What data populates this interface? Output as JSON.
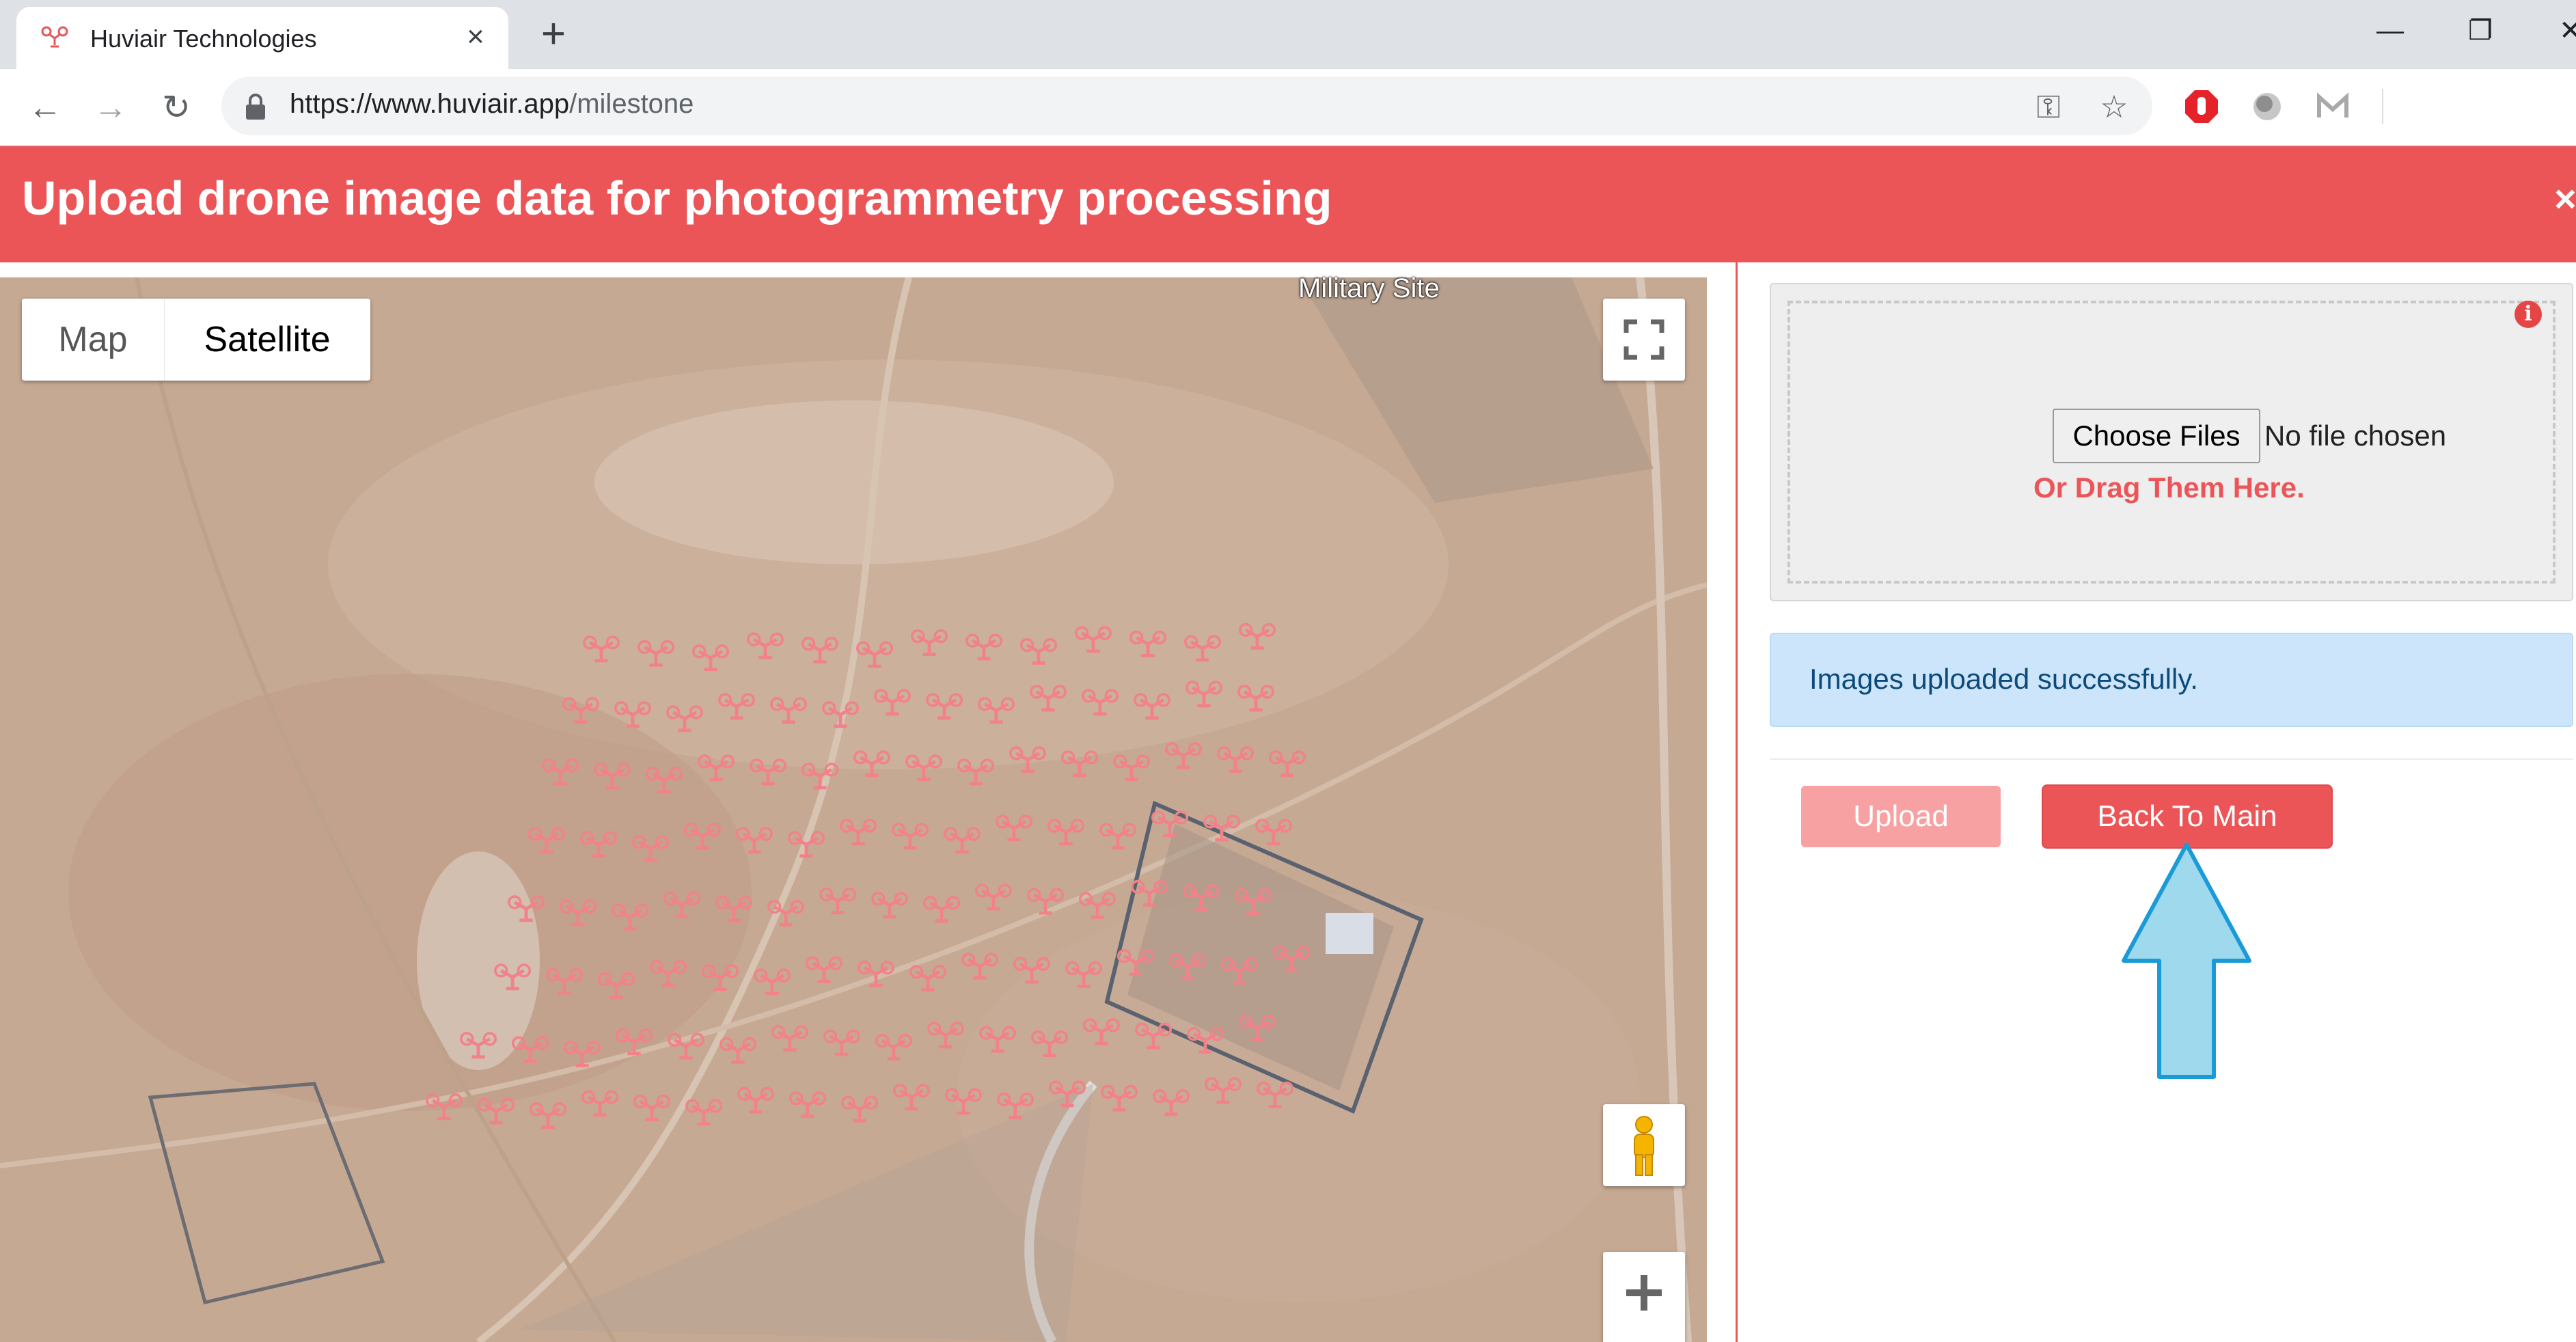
{
  "browser": {
    "tab_title": "Huviair Technologies",
    "tab_close_icon": "×",
    "new_tab_icon": "+",
    "url_host": "https://www.huviair.app",
    "url_path": "/milestone",
    "window_controls": {
      "minimize": "—",
      "restore": "❐",
      "close": "✕"
    },
    "icons": {
      "back": "←",
      "forward": "→",
      "reload": "↻",
      "key": "⚿",
      "star": "☆"
    }
  },
  "header": {
    "title": "Upload drone image data for photogrammetry processing",
    "close_icon": "×"
  },
  "map": {
    "type_map": "Map",
    "type_satellite": "Satellite",
    "selected_type": "Satellite",
    "place_label": "Military Site",
    "zoom_in_icon": "+",
    "fullscreen_icon": "fullscreen-icon",
    "pegman_icon": "pegman-icon",
    "marker_icon": "drone-icon"
  },
  "upload": {
    "choose_files_label": "Choose Files",
    "file_status": "No file chosen",
    "drag_hint": "Or Drag Them Here.",
    "info_icon": "i",
    "success_message": "Images uploaded successfully.",
    "upload_button": "Upload",
    "back_button": "Back To Main"
  },
  "colors": {
    "brand": "#ec5558",
    "upload_disabled": "#f8a1a3",
    "alert_bg": "#cde5fa",
    "annotation_arrow": "#9fd9ee"
  }
}
